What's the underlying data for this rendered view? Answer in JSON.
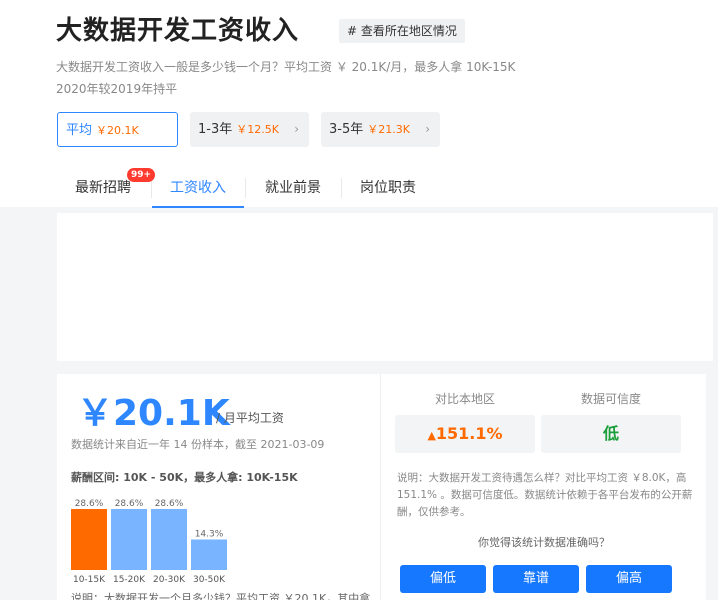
{
  "header": {
    "title": "大数据开发工资收入",
    "region_button": "# 查看所在地区情况",
    "desc_line1": "大数据开发工资收入一般是多少钱一个月？平均工资 ￥ 20.1K/月，最多人拿 10K-15K",
    "desc_line2": "2020年较2019年持平"
  },
  "stats": [
    {
      "label": "平均",
      "value": "￥20.1K",
      "chevron": ""
    },
    {
      "label": "1-3年",
      "value": "￥12.5K",
      "chevron": "›"
    },
    {
      "label": "3-5年",
      "value": "￥21.3K",
      "chevron": "›"
    }
  ],
  "tabs": [
    {
      "label": "最新招聘"
    },
    {
      "label": "工资收入"
    },
    {
      "label": "就业前景"
    },
    {
      "label": "岗位职责"
    }
  ],
  "badge": "99+",
  "salary": {
    "big": "￥20.1K",
    "sub": "/ 月平均工资",
    "sample": "数据统计来自近一年 14 份样本，截至 2021-03-09",
    "range": "薪酬区间: 10K - 50K，最多人拿: 10K-15K",
    "bottom_text": "说明：大数据开发一个月多少钱？平均工资 ￥20.1K，其中拿"
  },
  "chart_data": {
    "type": "bar",
    "categories": [
      "10-15K",
      "15-20K",
      "20-30K",
      "30-50K"
    ],
    "values": [
      28.6,
      28.6,
      28.6,
      14.3
    ],
    "labels": [
      "28.6%",
      "28.6%",
      "28.6%",
      "14.3%"
    ],
    "colors": [
      "#ff6a00",
      "#78b4ff",
      "#78b4ff",
      "#78b4ff"
    ],
    "ylim": [
      0,
      30
    ]
  },
  "compare": {
    "label_left": "对比本地区",
    "label_right": "数据可信度",
    "value_left": "151.1%",
    "value_right": "低",
    "up_arrow": "▲",
    "note": "说明：大数据开发工资待遇怎么样？对比平均工资 ￥8.0K，高 151.1% 。数据可信度低。数据统计依赖于各平台发布的公开薪酬，仅供参考。",
    "question": "你觉得该统计数据准确吗？",
    "buttons": [
      "偏低",
      "靠谱",
      "偏高"
    ]
  },
  "colors": {
    "accent": "#2e87ff",
    "orange": "#ff6a00",
    "green": "#1c9f3a"
  }
}
